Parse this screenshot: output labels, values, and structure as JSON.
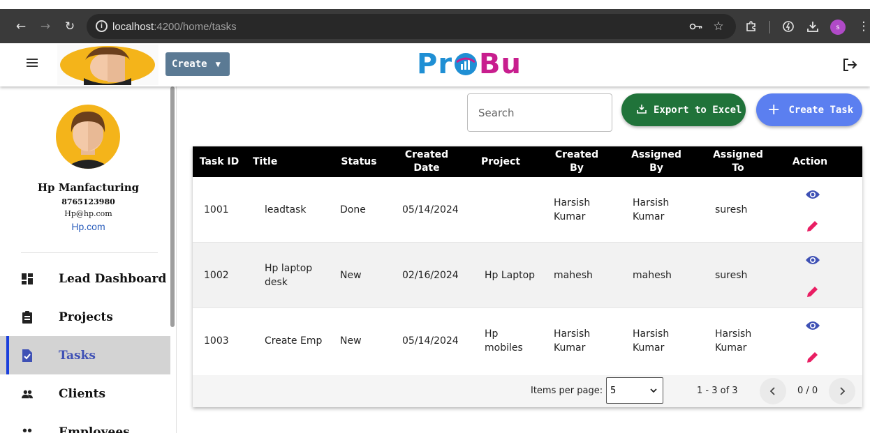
{
  "browser": {
    "url_host": "localhost",
    "url_path": ":4200/home/tasks",
    "profile_initial": "s"
  },
  "header": {
    "create_label": "Create",
    "brand_left": "Pr",
    "brand_right": "Bu"
  },
  "sidebar": {
    "company_name": "Hp Manfacturing",
    "phone": "8765123980",
    "email": "Hp@hp.com",
    "website": "Hp.com",
    "items": [
      {
        "label": "Lead Dashboard",
        "icon": "dashboard-icon"
      },
      {
        "label": "Projects",
        "icon": "clipboard-icon"
      },
      {
        "label": "Tasks",
        "icon": "task-icon"
      },
      {
        "label": "Clients",
        "icon": "clients-icon"
      },
      {
        "label": "Employees",
        "icon": "employees-icon"
      }
    ],
    "active": "Tasks"
  },
  "toolbar": {
    "search_placeholder": "Search",
    "export_label": "Export to Excel",
    "create_task_label": "Create Task"
  },
  "table": {
    "headers": [
      "Task ID",
      "Title",
      "Status",
      "Created Date",
      "Project",
      "Created By",
      "Assigned By",
      "Assigned To",
      "Action"
    ],
    "rows": [
      {
        "id": "1001",
        "title": "leadtask",
        "status": "Done",
        "created_date": "05/14/2024",
        "project": "",
        "created_by": "Harsish Kumar",
        "assigned_by": "Harsish Kumar",
        "assigned_to": "suresh"
      },
      {
        "id": "1002",
        "title": "Hp laptop desk",
        "status": "New",
        "created_date": "02/16/2024",
        "project": "Hp Laptop",
        "created_by": "mahesh",
        "assigned_by": "mahesh",
        "assigned_to": "suresh"
      },
      {
        "id": "1003",
        "title": "Create Emp",
        "status": "New",
        "created_date": "05/14/2024",
        "project": "Hp mobiles",
        "created_by": "Harsish Kumar",
        "assigned_by": "Harsish Kumar",
        "assigned_to": "Harsish Kumar"
      }
    ]
  },
  "paginator": {
    "items_per_page_label": "Items per page:",
    "items_per_page_value": "5",
    "range_label": "1 - 3 of 3",
    "page_label": "0 / 0"
  },
  "colors": {
    "export": "#20733a",
    "create_task": "#5b7ff0",
    "view_icon": "#3f51b5",
    "edit_icon": "#e91e63",
    "active_menu_bar": "#1a3fdc"
  }
}
